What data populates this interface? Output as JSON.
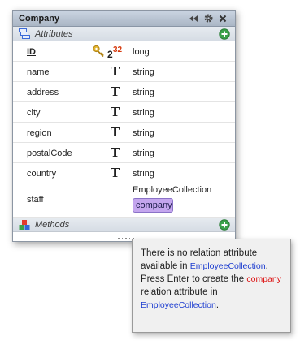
{
  "panel": {
    "title": "Company",
    "colors": {
      "accent_green": "#3aa14a",
      "input_bg": "#c4a6ee"
    }
  },
  "sections": {
    "attributes_label": "Attributes",
    "methods_label": "Methods"
  },
  "attributes": [
    {
      "name": "ID",
      "type": "long",
      "is_key": true,
      "auto_number_label": "2",
      "auto_number_sup": "32"
    },
    {
      "name": "name",
      "type": "string",
      "type_glyph": "T"
    },
    {
      "name": "address",
      "type": "string",
      "type_glyph": "T"
    },
    {
      "name": "city",
      "type": "string",
      "type_glyph": "T"
    },
    {
      "name": "region",
      "type": "string",
      "type_glyph": "T"
    },
    {
      "name": "postalCode",
      "type": "string",
      "type_glyph": "T"
    },
    {
      "name": "country",
      "type": "string",
      "type_glyph": "T"
    }
  ],
  "staff": {
    "name": "staff",
    "type": "EmployeeCollection",
    "input_value": "company"
  },
  "tooltip": {
    "part1": "There is no relation attribute available in",
    "collection1": "EmployeeCollection",
    "part2": ". Press Enter to create the",
    "attr": "company",
    "part3": "relation attribute in",
    "collection2": "EmployeeCollection",
    "part4": "."
  }
}
